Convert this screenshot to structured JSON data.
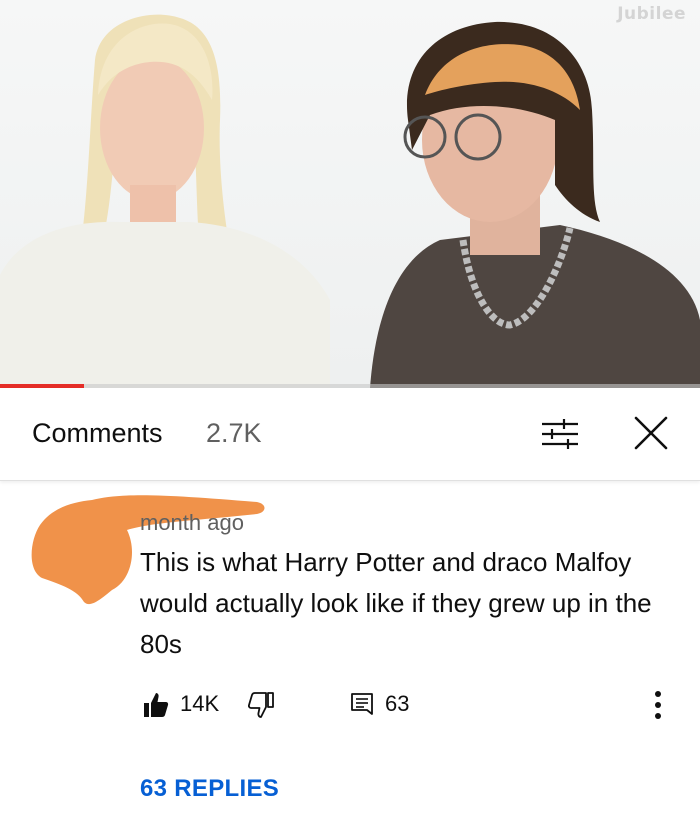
{
  "video": {
    "watermark": "Jubilee",
    "progress_fraction": 0.12
  },
  "comments_header": {
    "title": "Comments",
    "count": "2.7K",
    "sort_icon": "sort-filter-icon",
    "close_icon": "close-icon"
  },
  "comment": {
    "meta": "month ago",
    "text": "This is what Harry Potter and draco Malfoy would actually look like if they grew up in the 80s",
    "likes": "14K",
    "replies_count": "63",
    "replies_link": "63 REPLIES"
  },
  "colors": {
    "scribble": "#f0924a",
    "link": "#065fd4",
    "progress": "#e52d27"
  }
}
